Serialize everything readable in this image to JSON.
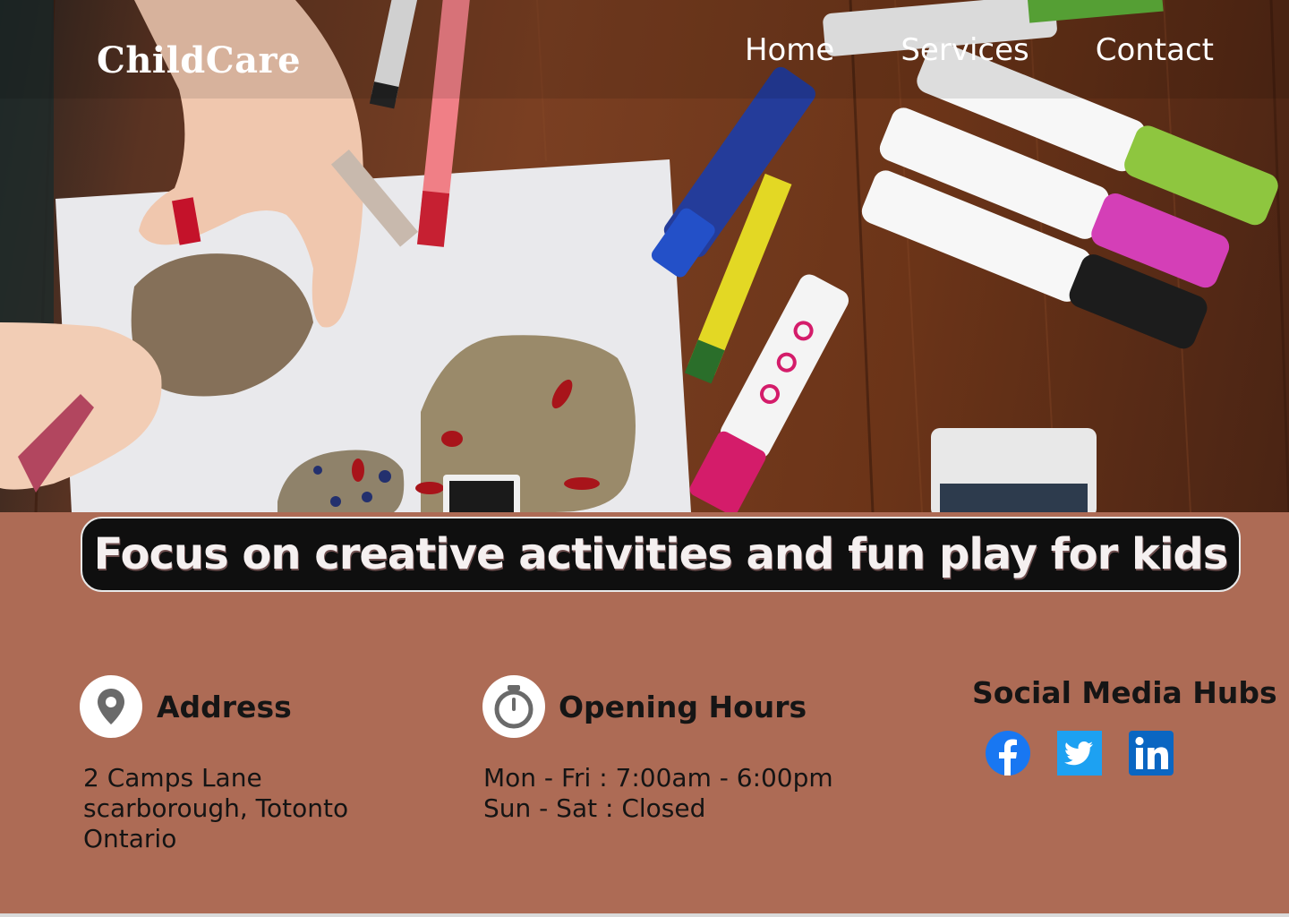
{
  "header": {
    "brand": "ChildCare",
    "nav": [
      {
        "label": "Home"
      },
      {
        "label": "Services"
      },
      {
        "label": "Contact"
      }
    ]
  },
  "banner": {
    "text": "Focus on creative activities and fun play for kids"
  },
  "address": {
    "title": "Address",
    "icon": "location-pin-icon",
    "lines": [
      "2 Camps Lane",
      "scarborough, Totonto",
      "Ontario"
    ]
  },
  "hours": {
    "title": "Opening Hours",
    "icon": "stopwatch-icon",
    "lines": [
      "Mon - Fri : 7:00am - 6:00pm",
      "Sun - Sat : Closed"
    ]
  },
  "social": {
    "title": "Social Media Hubs",
    "links": [
      {
        "icon": "facebook-icon",
        "color": "#1877f2"
      },
      {
        "icon": "twitter-icon",
        "color": "#1da1f2"
      },
      {
        "icon": "linkedin-icon",
        "color": "#0a66c2"
      }
    ]
  },
  "colors": {
    "page_background": "#ad6b55",
    "banner_background": "#0f0f0f",
    "text_dark": "#151515"
  }
}
